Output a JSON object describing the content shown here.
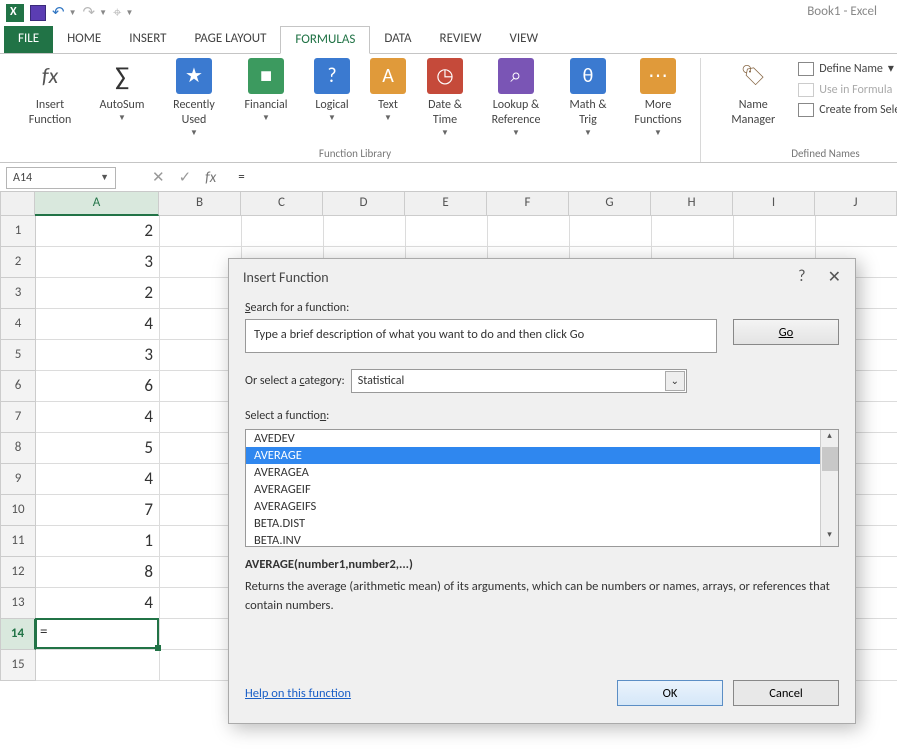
{
  "app": {
    "title": "Book1 - Excel"
  },
  "tabs": [
    "FILE",
    "HOME",
    "INSERT",
    "PAGE LAYOUT",
    "FORMULAS",
    "DATA",
    "REVIEW",
    "VIEW"
  ],
  "active_tab": "FORMULAS",
  "ribbon": {
    "insert_function": "Insert\nFunction",
    "autosum": "AutoSum",
    "recent": "Recently\nUsed",
    "financial": "Financial",
    "logical": "Logical",
    "text": "Text",
    "datetime": "Date &\nTime",
    "lookup": "Lookup &\nReference",
    "math": "Math &\nTrig",
    "more": "More\nFunctions",
    "name_manager": "Name\nManager",
    "define_name": "Define Name",
    "use_in_formula": "Use in Formula",
    "create_from_selection": "Create from Selection",
    "group1": "Function Library",
    "group2": "Defined Names"
  },
  "fbar": {
    "name": "A14",
    "value": "="
  },
  "columns": [
    "A",
    "B",
    "C",
    "D",
    "E",
    "F",
    "G",
    "H",
    "I",
    "J"
  ],
  "selected_col_idx": 0,
  "rows": [
    {
      "n": 1,
      "A": "2"
    },
    {
      "n": 2,
      "A": "3"
    },
    {
      "n": 3,
      "A": "2"
    },
    {
      "n": 4,
      "A": "4"
    },
    {
      "n": 5,
      "A": "3"
    },
    {
      "n": 6,
      "A": "6"
    },
    {
      "n": 7,
      "A": "4"
    },
    {
      "n": 8,
      "A": "5"
    },
    {
      "n": 9,
      "A": "4"
    },
    {
      "n": 10,
      "A": "7"
    },
    {
      "n": 11,
      "A": "1"
    },
    {
      "n": 12,
      "A": "8"
    },
    {
      "n": 13,
      "A": "4"
    },
    {
      "n": 14,
      "A": "="
    },
    {
      "n": 15,
      "A": ""
    }
  ],
  "active_row": 14,
  "dialog": {
    "title": "Insert Function",
    "search_label_pre": "S",
    "search_label_post": "earch for a function:",
    "search_placeholder": "Type a brief description of what you want to do and then click Go",
    "go": "Go",
    "go_u": "G",
    "go_rest": "o",
    "category_label": "Or select a category:",
    "category_u": "c",
    "category": "Statistical",
    "select_label_pre": "Select a functio",
    "select_label_u": "n",
    "select_label_post": ":",
    "functions": [
      "AVEDEV",
      "AVERAGE",
      "AVERAGEA",
      "AVERAGEIF",
      "AVERAGEIFS",
      "BETA.DIST",
      "BETA.INV"
    ],
    "selected_function": "AVERAGE",
    "signature": "AVERAGE(number1,number2,...)",
    "description": "Returns the average (arithmetic mean) of its arguments, which can be numbers or names, arrays, or references that contain numbers.",
    "help": "Help on this function",
    "ok": "OK",
    "cancel": "Cancel"
  }
}
